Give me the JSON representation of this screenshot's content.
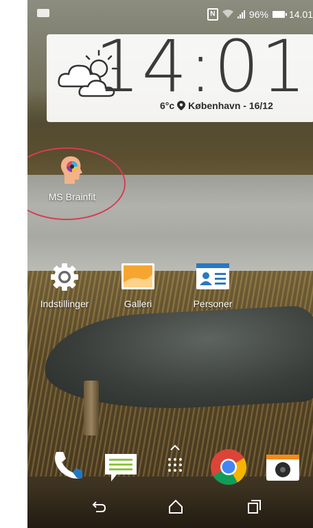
{
  "status_bar": {
    "battery_percent": "96%",
    "time": "14.01"
  },
  "clock_widget": {
    "time": "14:01",
    "temperature": "6°c",
    "location_date": "København - 16/12"
  },
  "apps": {
    "brainfit": "MS Brainfit",
    "settings": "Indstillinger",
    "gallery": "Galleri",
    "contacts": "Personer"
  },
  "colors": {
    "annotation": "#d83c52",
    "chrome_red": "#db4437",
    "chrome_green": "#0f9d58",
    "chrome_yellow": "#f4b400",
    "chrome_blue": "#4285f4"
  },
  "icons": [
    "nfc-icon",
    "wifi-icon",
    "signal-icon",
    "battery-icon",
    "weather-partly-cloudy-icon",
    "location-pin-icon",
    "brainfit-icon",
    "gear-icon",
    "gallery-icon",
    "contacts-card-icon",
    "phone-icon",
    "messages-icon",
    "app-drawer-icon",
    "chrome-icon",
    "camera-icon",
    "back-icon",
    "home-icon",
    "recents-icon"
  ]
}
